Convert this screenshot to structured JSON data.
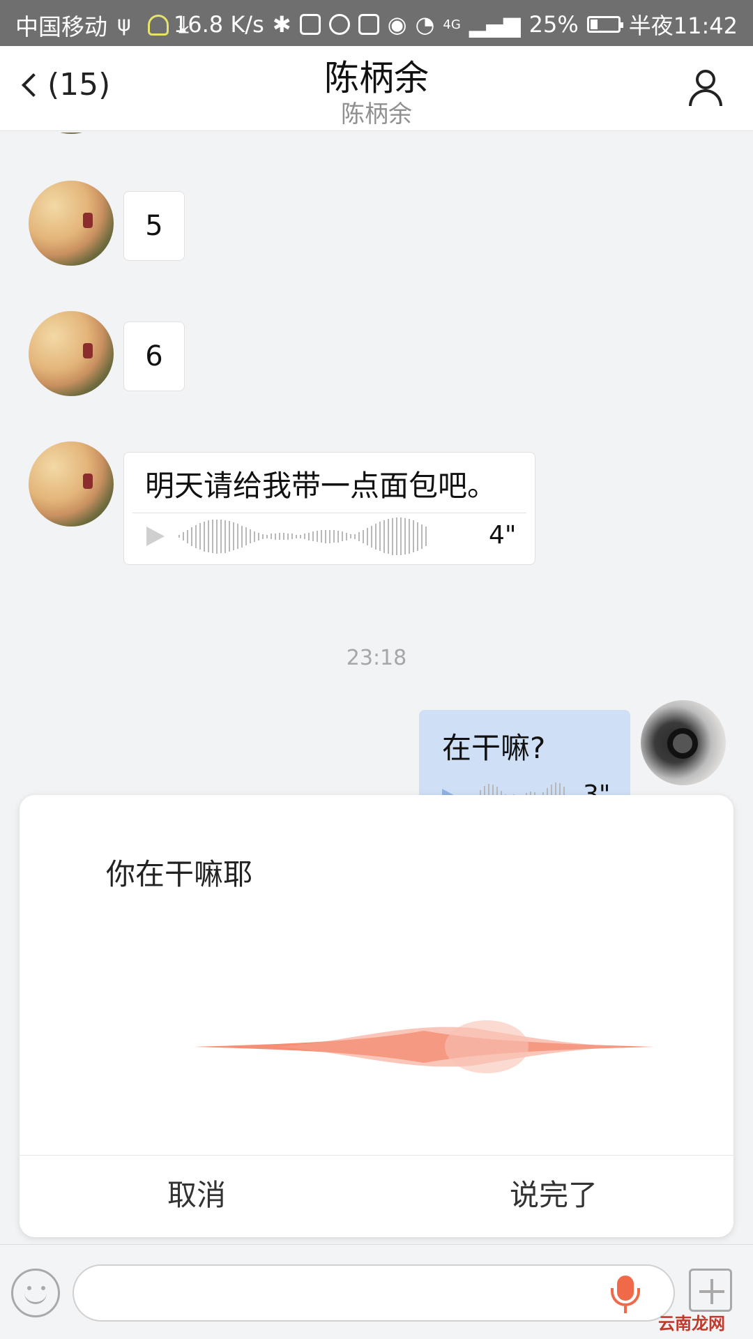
{
  "status_bar": {
    "carrier": "中国移动",
    "net_speed": "16.8 K/s",
    "signal_label": "4G",
    "battery": "25%",
    "time": "半夜11:42"
  },
  "header": {
    "back_label": "(15)",
    "title": "陈柄余",
    "subtitle": "陈柄余"
  },
  "messages": [
    {
      "type": "text",
      "text": "5"
    },
    {
      "type": "text",
      "text": "6"
    },
    {
      "type": "voice",
      "text": "明天请给我带一点面包吧。",
      "duration": "4\""
    }
  ],
  "timestamp": "23:18",
  "my_message": {
    "text": "在干嘛?",
    "duration": "3\""
  },
  "voice_dialog": {
    "recognized_text": "你在干嘛耶",
    "cancel_label": "取消",
    "done_label": "说完了"
  },
  "input_bar": {
    "placeholder": ""
  },
  "watermark": "云南龙网",
  "colors": {
    "accent": "#f06a4a",
    "my_bubble": "#cfe0f6",
    "status_bar": "#6f6f6f"
  }
}
